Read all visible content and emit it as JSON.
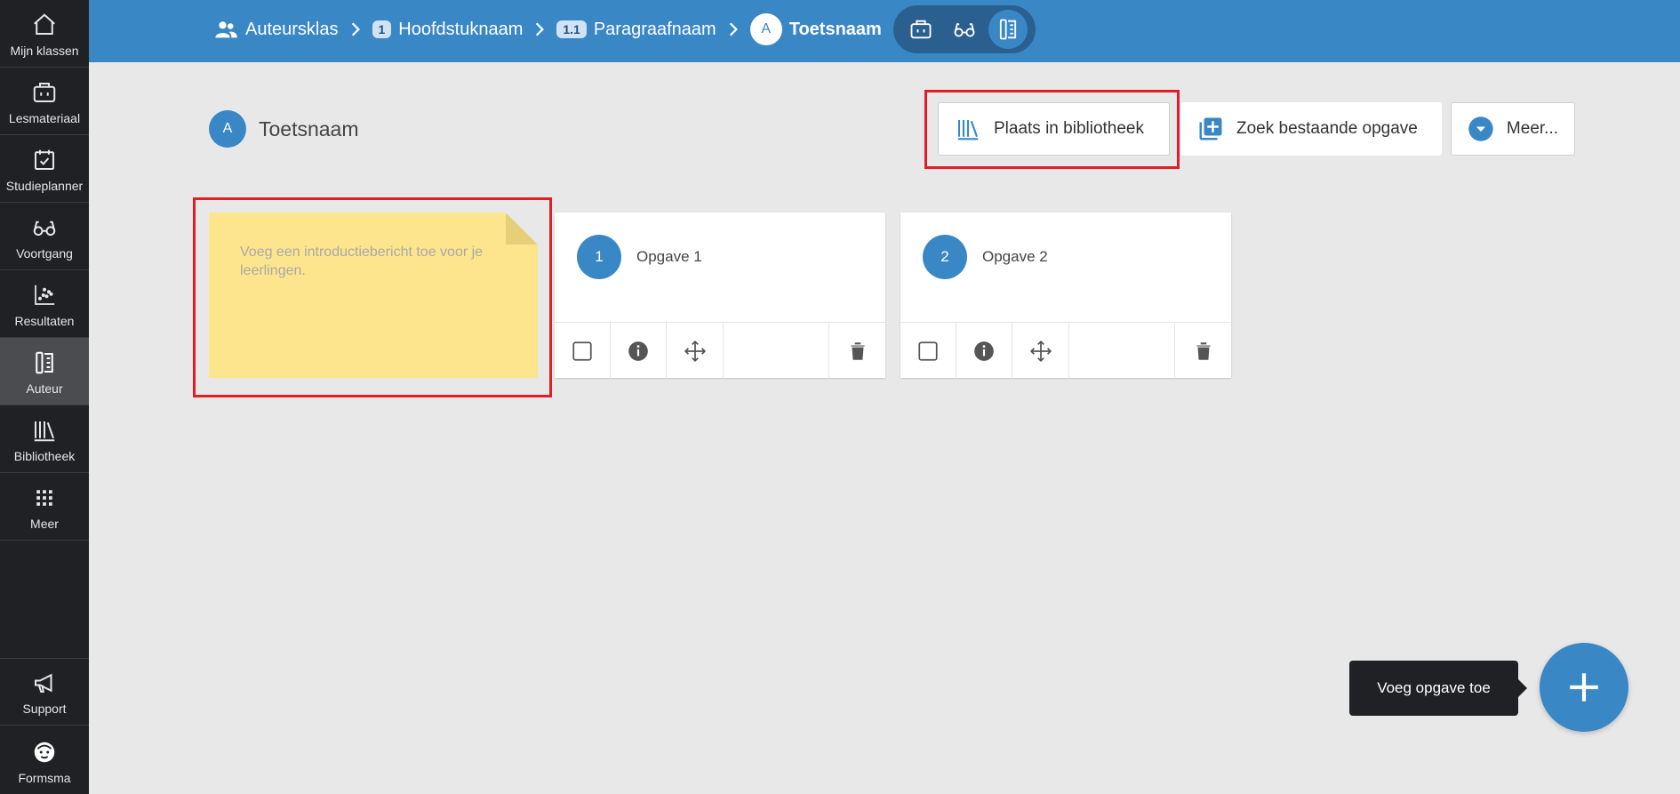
{
  "sidebar": {
    "items": [
      {
        "label": "Mijn klassen",
        "icon": "home-icon"
      },
      {
        "label": "Lesmateriaal",
        "icon": "briefcase-icon"
      },
      {
        "label": "Studieplanner",
        "icon": "calendar-check-icon"
      },
      {
        "label": "Voortgang",
        "icon": "glasses-icon"
      },
      {
        "label": "Resultaten",
        "icon": "scatter-chart-icon"
      },
      {
        "label": "Auteur",
        "icon": "author-edit-icon",
        "active": true
      },
      {
        "label": "Bibliotheek",
        "icon": "library-icon"
      },
      {
        "label": "Meer",
        "icon": "grid-icon"
      }
    ],
    "bottom": [
      {
        "label": "Support",
        "icon": "megaphone-icon"
      },
      {
        "label": "Formsma",
        "icon": "user-avatar-icon"
      }
    ]
  },
  "breadcrumb": {
    "class_name": "Auteursklas",
    "chapter_num": "1",
    "chapter_name": "Hoofdstuknaam",
    "paragraph_num": "1.1",
    "paragraph_name": "Paragraafnaam",
    "test_letter": "A",
    "test_name": "Toetsnaam"
  },
  "header": {
    "avatar_letter": "A",
    "title": "Toetsnaam",
    "btn_library": "Plaats in bibliotheek",
    "btn_search": "Zoek bestaande opgave",
    "btn_more": "Meer..."
  },
  "intro_note": {
    "placeholder": "Voeg een introductiebericht toe voor je leerlingen."
  },
  "tasks": [
    {
      "number": "1",
      "title": "Opgave 1"
    },
    {
      "number": "2",
      "title": "Opgave 2"
    }
  ],
  "fab": {
    "tooltip": "Voeg opgave toe"
  },
  "colors": {
    "accent": "#3a87c6",
    "sidebar": "#1f2125",
    "note": "#fde58e",
    "highlight": "#e01e26"
  }
}
